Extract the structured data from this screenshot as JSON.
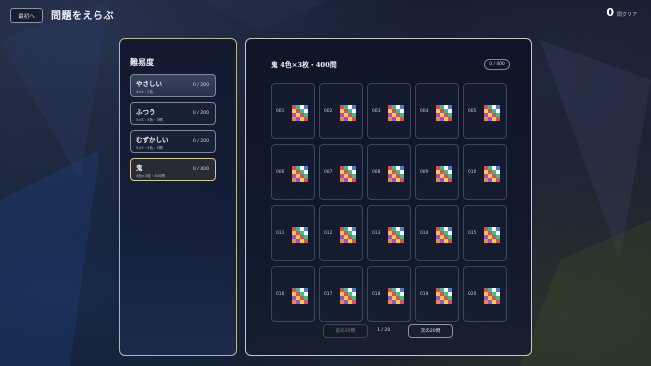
{
  "header": {
    "back_label": "最初へ",
    "title": "問題をえらぶ",
    "clear_count": "0",
    "clear_label": "問クリア"
  },
  "sidebar": {
    "title": "難易度",
    "items": [
      {
        "name": "やさしい",
        "sub": "4×4・2色",
        "progress": "0 / 200"
      },
      {
        "name": "ふつう",
        "sub": "5×5・3色・5問",
        "progress": "0 / 200"
      },
      {
        "name": "むずかしい",
        "sub": "5×5・3色・5問",
        "progress": "0 / 200"
      },
      {
        "name": "鬼",
        "sub": "4色×3枚・400問",
        "progress": "0 / 400"
      }
    ]
  },
  "main": {
    "set_title": "鬼 4色×3枚・400問",
    "set_badge": "0 / 400",
    "puzzles": [
      "001",
      "002",
      "003",
      "004",
      "005",
      "006",
      "007",
      "008",
      "009",
      "010",
      "011",
      "012",
      "013",
      "014",
      "015",
      "016",
      "017",
      "018",
      "019",
      "020"
    ],
    "prev_label": "前の20問",
    "page_info": "1 / 20",
    "next_label": "次の20問"
  },
  "colors": {
    "accent_gold": "#d9c98a",
    "tile_palette": [
      "#e04a5a",
      "#4a7ae0",
      "#f0d040",
      "#ffffff",
      "#a04ae0",
      "#40c080",
      "#f08a30"
    ]
  }
}
